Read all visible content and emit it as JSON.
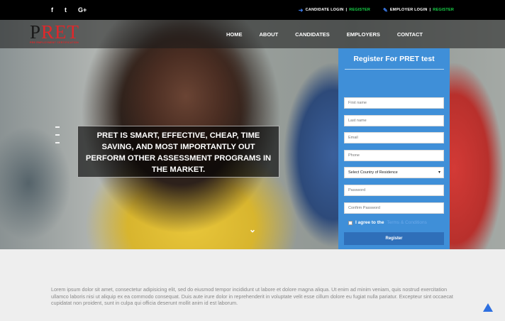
{
  "topbar": {
    "social": [
      {
        "icon": "facebook-icon",
        "glyph": "f"
      },
      {
        "icon": "twitter-icon",
        "glyph": "t"
      },
      {
        "icon": "google-plus-icon",
        "glyph": "G+"
      }
    ],
    "candidate_login": "CANDIDATE LOGIN",
    "employer_login": "EMPLOYER LOGIN",
    "separator": "|",
    "register": "REGISTER",
    "login_icon": "sign-in-icon",
    "employer_icon": "edit-icon"
  },
  "brand": {
    "logo_first": "P",
    "logo_rest": "RET",
    "tagline": "PRE EMPLOYMENT CERTIFICATION"
  },
  "nav": [
    "HOME",
    "ABOUT",
    "CANDIDATES",
    "EMPLOYERS",
    "CONTACT"
  ],
  "hero": {
    "headline": "PRET IS SMART, EFFECTIVE, CHEAP, TIME SAVING, AND MOST IMPORTANTLY OUT PERFORM OTHER ASSESSMENT PROGRAMS IN THE MARKET.",
    "scroll_icon": "chevron-down-icon"
  },
  "register_form": {
    "title": "Register For PRET test",
    "placeholders": {
      "first_name": "First name",
      "last_name": "Last name",
      "email": "Email",
      "phone": "Phone",
      "password": "Password",
      "confirm_password": "Confirm Password"
    },
    "country_select": "Select Country of Residence",
    "agree_text": "I agree to the",
    "terms_text": "Terms & Conditions",
    "button": "Register"
  },
  "content": {
    "paragraph": "Lorem ipsum dolor sit amet, consectetur adipisicing elit, sed do eiusmod tempor incididunt ut labore et dolore magna aliqua. Ut enim ad minim veniam, quis nostrud exercitation ullamco laboris nisi ut aliquip ex ea commodo consequat. Duis aute irure dolor in reprehenderit in voluptate velit esse cillum dolore eu fugiat nulla pariatur. Excepteur sint occaecat cupidatat non proident, sunt in culpa qui officia deserunt mollit anim id est laborum."
  },
  "colors": {
    "accent_blue": "#3f8fd8",
    "register_green": "#18d64a",
    "logo_red": "#e0272a"
  }
}
